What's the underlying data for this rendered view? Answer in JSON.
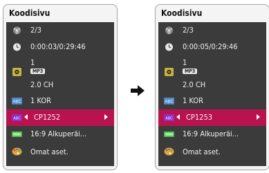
{
  "panels": [
    {
      "title": "Koodisivu",
      "title_label": "Koodisivu",
      "items": {
        "title_value": "2/3",
        "time": "0:00:03/0:29:46",
        "audio_track": "1",
        "audio_codec": "MP3",
        "audio_channels": "2.0 CH",
        "subtitle": "1 KOR",
        "code_page": "CP1252",
        "aspect": "16:9 Alkuperäi...",
        "settings": "Omat aset."
      }
    },
    {
      "title": "Koodisivu",
      "title_label": "Koodisivu",
      "items": {
        "title_value": "2/3",
        "time": "0:00:05/0:29:46",
        "audio_track": "1",
        "audio_codec": "MP3",
        "audio_channels": "2.0 CH",
        "subtitle": "1 KOR",
        "code_page": "CP1253",
        "aspect": "16:9 Alkuperäi...",
        "settings": "Omat aset."
      }
    }
  ],
  "colors": {
    "panel_bg": "#3b3b3b",
    "selected_row": "#b8134f",
    "text": "#f0f0f0"
  },
  "icons": [
    "film-reel-icon",
    "clock-icon",
    "speaker-icon",
    "abc-icon",
    "abc-code-icon",
    "screen-ratio-icon",
    "palette-icon"
  ]
}
